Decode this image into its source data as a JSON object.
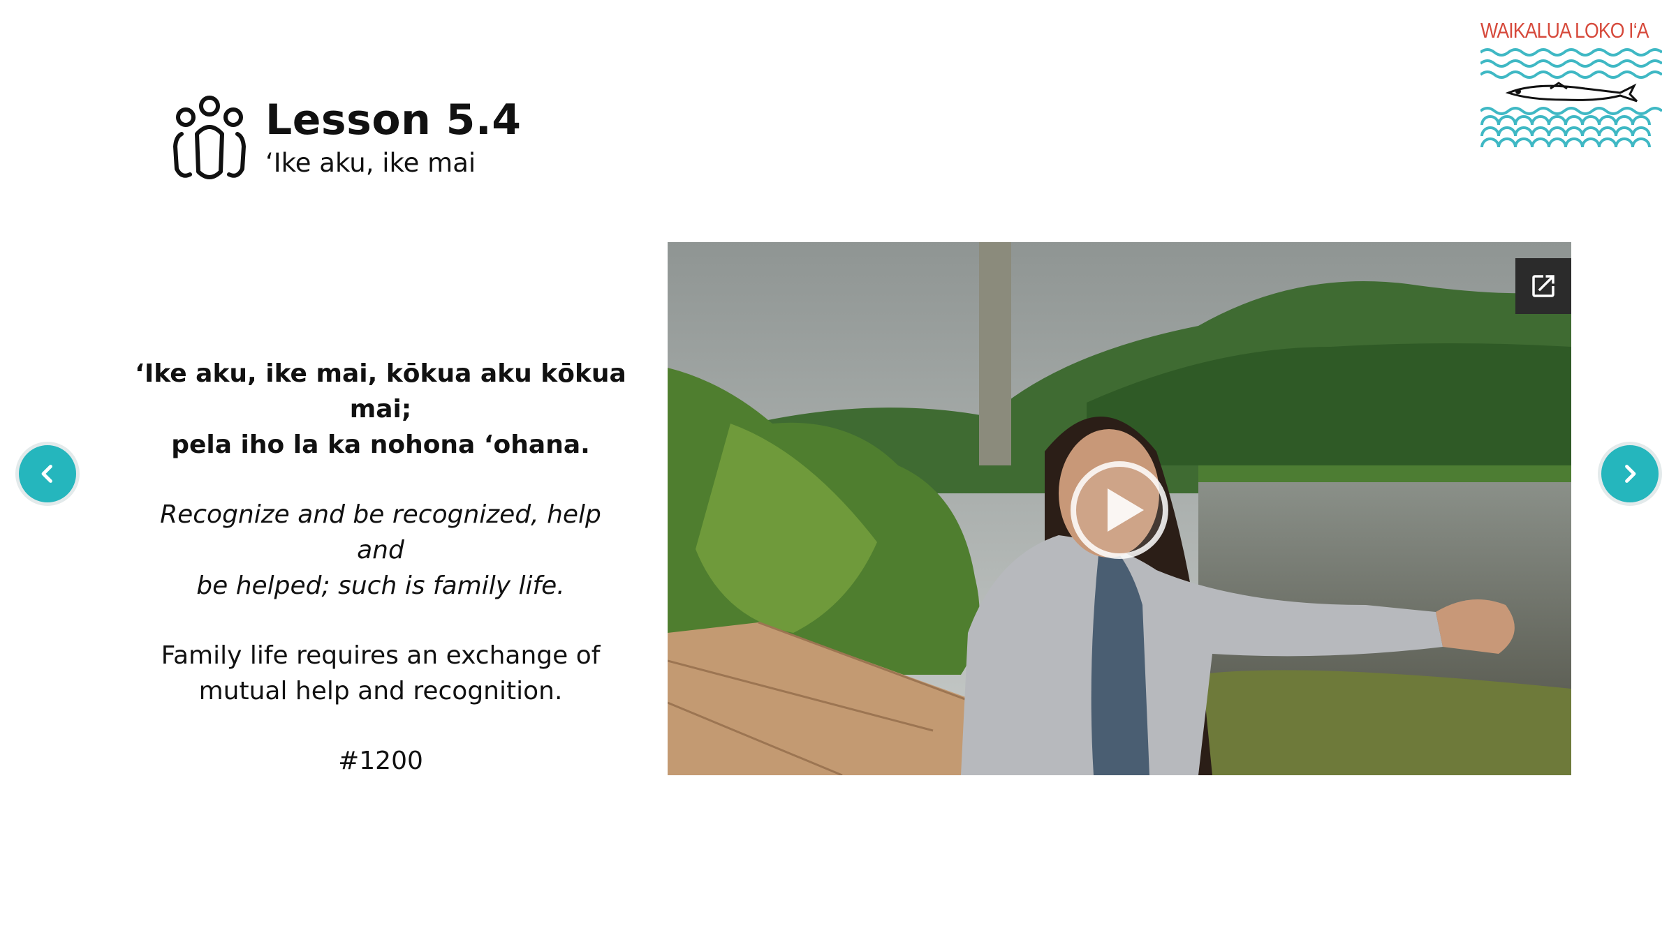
{
  "header": {
    "icon": "family-icon",
    "title": "Lesson 5.4",
    "subtitle": "‘Ike aku, ike mai"
  },
  "logo": {
    "text": "WAIKALUA LOKO I‘A",
    "text_color": "#d6493b",
    "wave_color": "#3fb8c4"
  },
  "quote": {
    "hawaiian_line1": "‘Ike aku, ike mai, kōkua aku kōkua mai;",
    "hawaiian_line2": "pela iho la ka nohona ‘ohana.",
    "english_line1": "Recognize and be recognized, help and",
    "english_line2": "be helped; such is family life.",
    "meaning_line1": "Family life requires an exchange of",
    "meaning_line2": "mutual help and recognition.",
    "number": "#1200"
  },
  "video": {
    "popout_icon": "open-in-new-icon",
    "play_icon": "play-icon"
  },
  "nav": {
    "prev_icon": "chevron-left-icon",
    "next_icon": "chevron-right-icon",
    "accent": "#25b6bd"
  }
}
